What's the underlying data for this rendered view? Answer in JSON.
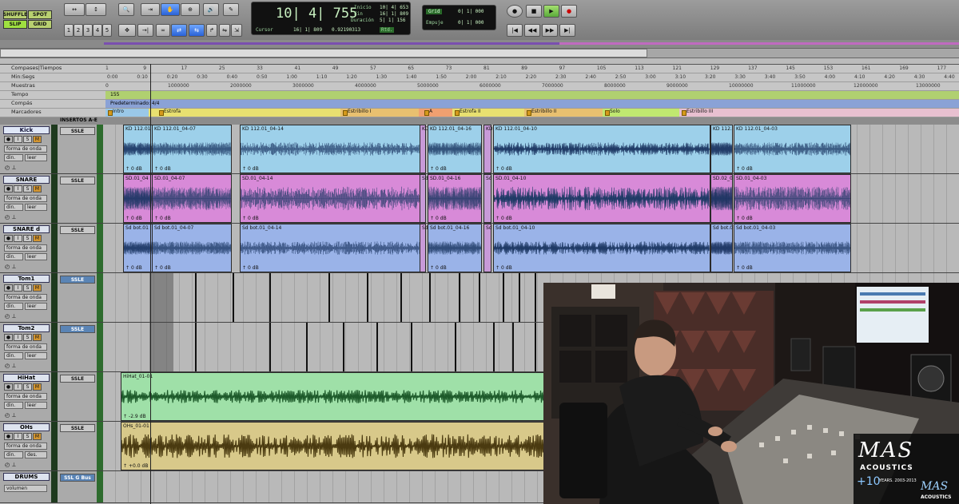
{
  "toolbar": {
    "modes": [
      "SHUFFLE",
      "SPOT",
      "SLIP",
      "GRID"
    ],
    "numbers": [
      "1",
      "2",
      "3",
      "4",
      "5"
    ],
    "counter": {
      "big": "10| 4| 755",
      "inicio_label": "Inicio",
      "inicio": "10| 4| 653",
      "fin_label": "Fin",
      "fin": "16| 1| 809",
      "duracion_label": "Duración",
      "duracion": "5| 1| 156",
      "cursor_label": "Cursor",
      "cursor": "16| 1| 809",
      "samples": "0.92190313",
      "rtd_label": "Rtd."
    },
    "grid": {
      "grid_label": "Grid",
      "grid": "0| 1| 000",
      "nudge_label": "Empuje",
      "nudge": "0| 1| 000"
    }
  },
  "rulers": {
    "labels": [
      "Compases|Tiempos",
      "Min:Segs",
      "Muestras",
      "Tempo",
      "Compás",
      "Marcadores"
    ],
    "bars": [
      "1",
      "9",
      "17",
      "25",
      "33",
      "41",
      "49",
      "57",
      "65",
      "73",
      "81",
      "89",
      "97",
      "105",
      "113",
      "121",
      "129",
      "137",
      "145",
      "153",
      "161",
      "169",
      "177"
    ],
    "mins": [
      "0:00",
      "0:10",
      "0:20",
      "0:30",
      "0:40",
      "0:50",
      "1:00",
      "1:10",
      "1:20",
      "1:30",
      "1:40",
      "1:50",
      "2:00",
      "2:10",
      "2:20",
      "2:30",
      "2:40",
      "2:50",
      "3:00",
      "3:10",
      "3:20",
      "3:30",
      "3:40",
      "3:50",
      "4:00",
      "4:10",
      "4:20",
      "4:30",
      "4:40"
    ],
    "samples": [
      "0",
      "1000000",
      "2000000",
      "3000000",
      "4000000",
      "5000000",
      "6000000",
      "7000000",
      "8000000",
      "9000000",
      "10000000",
      "11000000",
      "12000000",
      "13000000"
    ],
    "tempo": "155",
    "meter": "Predeterminado: 4/4",
    "markers": [
      "Intro",
      "Estrofa",
      "Estribillo I",
      "A",
      "Estrofa II",
      "Estribillo II",
      "Solo",
      "Estribillo III"
    ]
  },
  "header": {
    "inserts": "INSERTOS A-E"
  },
  "tracks": [
    {
      "name": "Kick",
      "insert": "SSLE",
      "view": "forma de onda",
      "mode": "din.",
      "extra": "leer",
      "color": "#9dd0ea",
      "gain": "0 dB",
      "clips": [
        "KD 112.01",
        "KD 112.01_04-07",
        "KD 112.01_04-14",
        "KD",
        "KD 112.01_04-16",
        "KD",
        "KD 112.01_04-10",
        "KD 112.",
        "KD 112.01_04-03"
      ]
    },
    {
      "name": "SNARE",
      "insert": "SSLE",
      "view": "forma de onda",
      "mode": "din.",
      "extra": "leer",
      "color": "#d88ad8",
      "gain": "0 dB",
      "clips": [
        "SD.01_04",
        "SD.01_04-07",
        "SD.01_04-14",
        "Sd",
        "SD.01_04-16",
        "Sd",
        "SD.01_04-10",
        "SD.02_0",
        "SD.01_04-03"
      ]
    },
    {
      "name": "SNARE d",
      "insert": "SSLE",
      "view": "forma de onda",
      "mode": "din.",
      "extra": "leer",
      "color": "#9ab3e8",
      "gain": "0 dB",
      "clips": [
        "Sd bot.01",
        "Sd bot.01_04-07",
        "Sd bot.01_04-14",
        "Sd",
        "Sd bot.01_04-16",
        "Sd",
        "Sd bot.01_04-10",
        "Sd bot.0",
        "Sd bot.01_04-03"
      ]
    },
    {
      "name": "Tom1",
      "insert": "SSLE",
      "view": "forma de onda",
      "mode": "din.",
      "extra": "leer",
      "color": "#aaaaaa",
      "gain": "",
      "clips": []
    },
    {
      "name": "Tom2",
      "insert": "SSLE",
      "view": "forma de onda",
      "mode": "din.",
      "extra": "leer",
      "color": "#aaaaaa",
      "gain": "",
      "clips": []
    },
    {
      "name": "HiHat",
      "insert": "SSLE",
      "view": "forma de onda",
      "mode": "din.",
      "extra": "leer",
      "color": "#9fe0a8",
      "gain": "-2.9 dB",
      "clips": [
        "HiHat_01-01"
      ]
    },
    {
      "name": "OHs",
      "insert": "SSLE",
      "view": "forma de onda",
      "mode": "din.",
      "extra": "des.",
      "color": "#d8c98a",
      "gain": "+0.0 dB",
      "clips": [
        "OHs_01-01"
      ]
    },
    {
      "name": "DRUMS",
      "insert": "SSL G Bus",
      "view": "volumen",
      "mode": "",
      "extra": "",
      "color": "#aaaaaa",
      "gain": "",
      "clips": []
    }
  ],
  "logo": {
    "brand": "MAS",
    "sub": "ACOUSTICS",
    "plus": "+10",
    "years": "YEARS. 2003-2013",
    "brand2": "MAS",
    "sub2": "ACOUSTICS"
  }
}
